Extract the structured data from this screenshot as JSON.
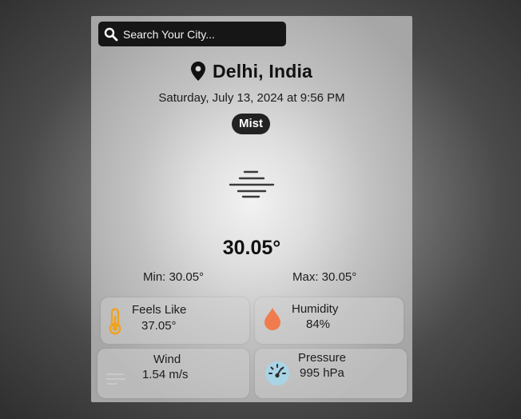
{
  "search": {
    "placeholder": "Search Your City...",
    "value": ""
  },
  "location": {
    "city": "Delhi, India"
  },
  "datetime": "Saturday, July 13, 2024 at 9:56 PM",
  "condition": "Mist",
  "temperature": "30.05°",
  "min": "Min: 30.05°",
  "max": "Max: 30.05°",
  "details": {
    "feels_like": {
      "label": "Feels Like",
      "value": "37.05°"
    },
    "humidity": {
      "label": "Humidity",
      "value": "84%"
    },
    "wind": {
      "label": "Wind",
      "value": "1.54 m/s"
    },
    "pressure": {
      "label": "Pressure",
      "value": "995 hPa"
    }
  },
  "icons": {
    "search": "search-icon",
    "location": "map-pin-icon",
    "weather": "mist-icon",
    "feels_like": "thermometer-icon",
    "humidity": "water-drop-icon",
    "wind": "wind-icon",
    "pressure": "gauge-icon"
  },
  "colors": {
    "search_bg": "#161616",
    "badge_bg": "#222222",
    "thermometer": "#f0a21d",
    "humidity_drop": "#f07b4e",
    "gauge": "#a9d4e6",
    "text": "#111111"
  }
}
